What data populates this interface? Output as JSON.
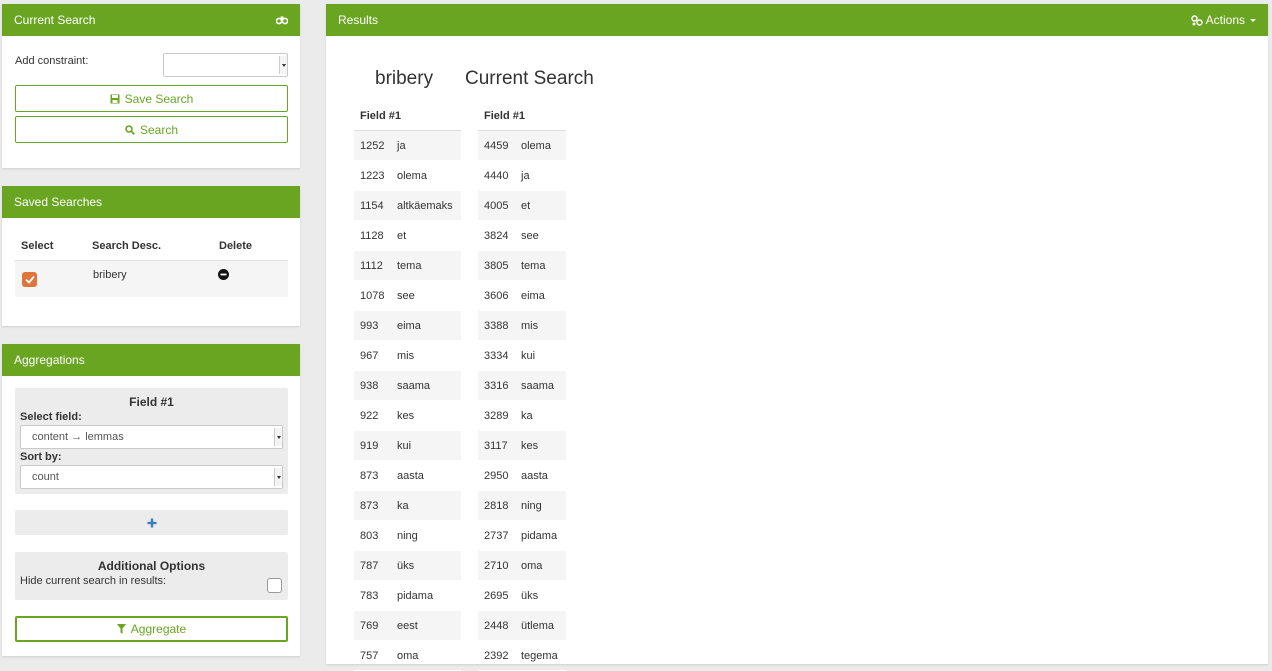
{
  "current_search": {
    "title": "Current Search",
    "add_constraint_label": "Add constraint:",
    "constraint_value": "",
    "save_button": "Save Search",
    "search_button": "Search"
  },
  "saved_searches": {
    "title": "Saved Searches",
    "columns": [
      "Select",
      "Search Desc.",
      "Delete"
    ],
    "rows": [
      {
        "desc": "bribery",
        "selected": true
      }
    ]
  },
  "aggregations": {
    "title": "Aggregations",
    "field_heading": "Field #1",
    "select_field_label": "Select field:",
    "select_field_value": "content → lemmas",
    "sort_by_label": "Sort by:",
    "sort_by_value": "count",
    "additional_options_title": "Additional Options",
    "hide_label": "Hide current search in results:",
    "aggregate_button": "Aggregate"
  },
  "results": {
    "title": "Results",
    "actions_label": "Actions",
    "tables": [
      {
        "heading": "bribery",
        "column": "Field #1",
        "rows": [
          [
            "1252",
            "ja"
          ],
          [
            "1223",
            "olema"
          ],
          [
            "1154",
            "altkäemaks"
          ],
          [
            "1128",
            "et"
          ],
          [
            "1112",
            "tema"
          ],
          [
            "1078",
            "see"
          ],
          [
            "993",
            "eima"
          ],
          [
            "967",
            "mis"
          ],
          [
            "938",
            "saama"
          ],
          [
            "922",
            "kes"
          ],
          [
            "919",
            "kui"
          ],
          [
            "873",
            "aasta"
          ],
          [
            "873",
            "ka"
          ],
          [
            "803",
            "ning"
          ],
          [
            "787",
            "üks"
          ],
          [
            "783",
            "pidama"
          ],
          [
            "769",
            "eest"
          ],
          [
            "757",
            "oma"
          ]
        ]
      },
      {
        "heading": "Current Search",
        "column": "Field #1",
        "rows": [
          [
            "4459",
            "olema"
          ],
          [
            "4440",
            "ja"
          ],
          [
            "4005",
            "et"
          ],
          [
            "3824",
            "see"
          ],
          [
            "3805",
            "tema"
          ],
          [
            "3606",
            "eima"
          ],
          [
            "3388",
            "mis"
          ],
          [
            "3334",
            "kui"
          ],
          [
            "3316",
            "saama"
          ],
          [
            "3289",
            "ka"
          ],
          [
            "3117",
            "kes"
          ],
          [
            "2950",
            "aasta"
          ],
          [
            "2818",
            "ning"
          ],
          [
            "2737",
            "pidama"
          ],
          [
            "2710",
            "oma"
          ],
          [
            "2695",
            "üks"
          ],
          [
            "2448",
            "ütlema"
          ],
          [
            "2392",
            "tegema"
          ]
        ]
      }
    ]
  },
  "colors": {
    "accent": "#6aa521",
    "checkbox": "#e0743a",
    "plus": "#3a7fc1"
  },
  "icons": [
    "binoculars-icon",
    "save-icon",
    "search-icon",
    "minus-circle-icon",
    "plus-icon",
    "filter-icon",
    "cogs-icon",
    "chevron-down-icon"
  ]
}
